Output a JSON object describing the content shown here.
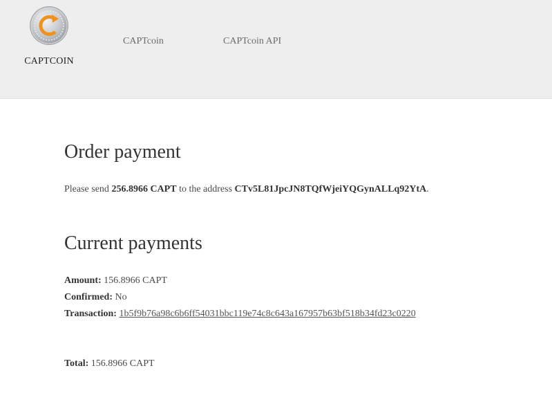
{
  "brand": {
    "name": "CAPTCOIN",
    "colors": {
      "accent": "#f0921e",
      "coin_silver": "#b9bcc0",
      "header_bg": "#eeeeee"
    },
    "logo_icon": "captcoin-coin-icon"
  },
  "nav": {
    "items": [
      {
        "label": "CAPTcoin"
      },
      {
        "label": "CAPTcoin API"
      }
    ]
  },
  "order": {
    "title": "Order payment",
    "prefix": "Please send ",
    "amount": "256.8966 CAPT",
    "middle": " to the address ",
    "address": "CTv5L81JpcJN8TQfWjeiYQGynALLq92YtA",
    "suffix": "."
  },
  "current": {
    "title": "Current payments",
    "amount_label": "Amount:",
    "amount_value": " 156.8966 CAPT",
    "confirmed_label": "Confirmed:",
    "confirmed_value": " No",
    "transaction_label": "Transaction:",
    "transaction_value": "1b5f9b76a98c6b6ff54031bbc119e74c8c643a167957b63bf518b34fd23c0220"
  },
  "total": {
    "label": "Total:",
    "value": " 156.8966 CAPT"
  }
}
